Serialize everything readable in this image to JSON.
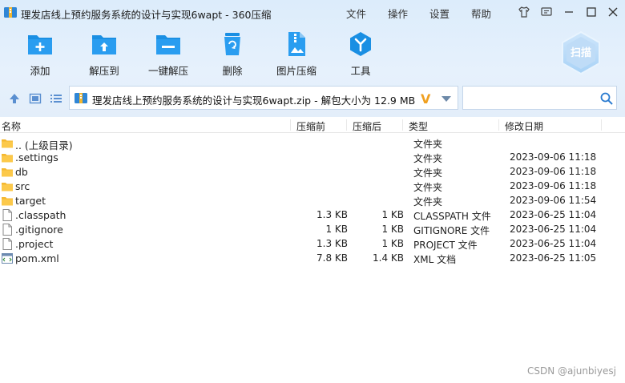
{
  "window": {
    "title": "理发店线上预约服务系统的设计与实现6wapt - 360压缩",
    "menu": [
      "文件",
      "操作",
      "设置",
      "帮助"
    ]
  },
  "toolbar": {
    "buttons": [
      {
        "label": "添加",
        "icon": "add-folder-icon"
      },
      {
        "label": "解压到",
        "icon": "extract-folder-icon"
      },
      {
        "label": "一键解压",
        "icon": "one-click-extract-icon"
      },
      {
        "label": "删除",
        "icon": "recycle-bin-icon"
      },
      {
        "label": "图片压缩",
        "icon": "image-compress-icon"
      },
      {
        "label": "工具",
        "icon": "tools-icon"
      }
    ],
    "scan_label": "扫描"
  },
  "address": {
    "path": "理发店线上预约服务系统的设计与实现6wapt.zip - 解包大小为 12.9 MB",
    "brand_mark": "V",
    "search_value": "",
    "search_placeholder": ""
  },
  "columns": {
    "name": "名称",
    "compressed": "压缩前",
    "original": "压缩后",
    "type": "类型",
    "modified": "修改日期"
  },
  "files": [
    {
      "name": ".. (上级目录)",
      "csize": "",
      "osize": "",
      "type": "文件夹",
      "mtime": "",
      "kind": "folder"
    },
    {
      "name": ".settings",
      "csize": "",
      "osize": "",
      "type": "文件夹",
      "mtime": "2023-09-06 11:18",
      "kind": "folder"
    },
    {
      "name": "db",
      "csize": "",
      "osize": "",
      "type": "文件夹",
      "mtime": "2023-09-06 11:18",
      "kind": "folder"
    },
    {
      "name": "src",
      "csize": "",
      "osize": "",
      "type": "文件夹",
      "mtime": "2023-09-06 11:18",
      "kind": "folder"
    },
    {
      "name": "target",
      "csize": "",
      "osize": "",
      "type": "文件夹",
      "mtime": "2023-09-06 11:54",
      "kind": "folder"
    },
    {
      "name": ".classpath",
      "csize": "1.3 KB",
      "osize": "1 KB",
      "type": "CLASSPATH 文件",
      "mtime": "2023-06-25 11:04",
      "kind": "file"
    },
    {
      "name": ".gitignore",
      "csize": "1 KB",
      "osize": "1 KB",
      "type": "GITIGNORE 文件",
      "mtime": "2023-06-25 11:04",
      "kind": "file"
    },
    {
      "name": ".project",
      "csize": "1.3 KB",
      "osize": "1 KB",
      "type": "PROJECT 文件",
      "mtime": "2023-06-25 11:04",
      "kind": "file"
    },
    {
      "name": "pom.xml",
      "csize": "7.8 KB",
      "osize": "1.4 KB",
      "type": "XML 文档",
      "mtime": "2023-06-25 11:05",
      "kind": "xml"
    }
  ],
  "watermark": "CSDN @ajunbiyesj",
  "colors": {
    "accent": "#1a8fe3",
    "chrome_bg": "#dcecfb",
    "folder": "#f5b830"
  }
}
